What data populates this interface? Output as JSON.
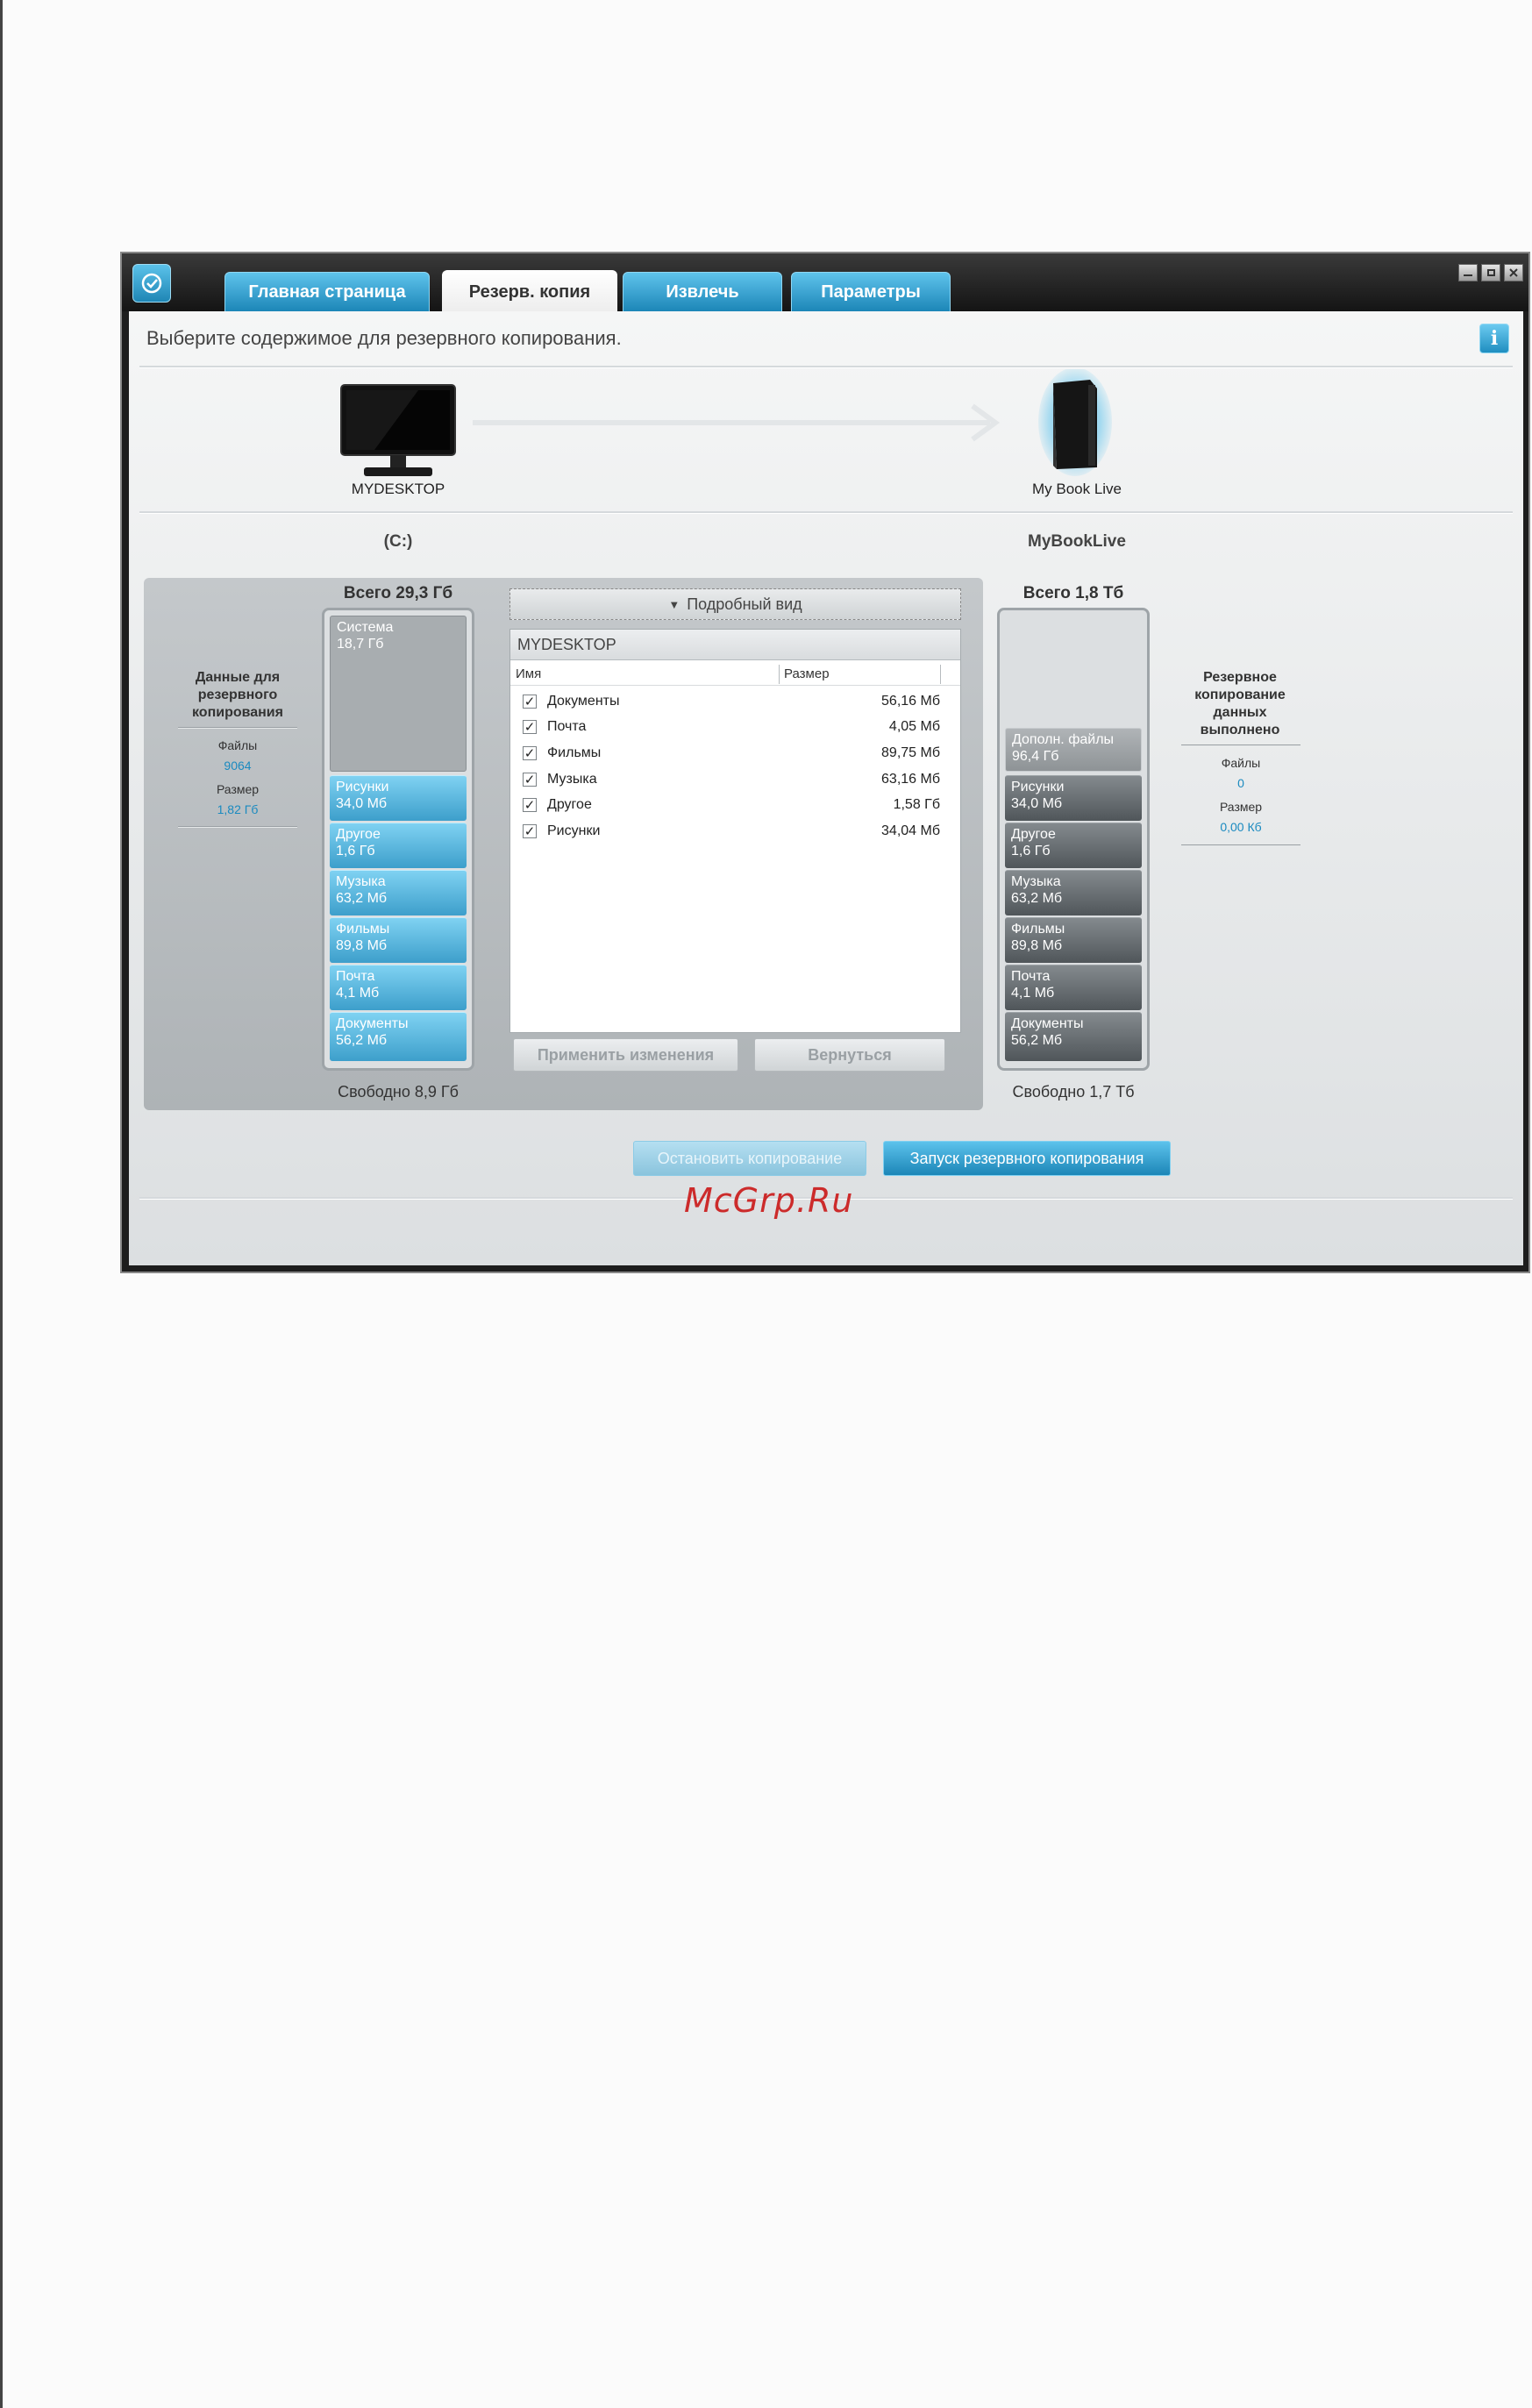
{
  "tabs": [
    "Главная страница",
    "Резерв. копия",
    "Извлечь",
    "Параметры"
  ],
  "instruction": "Выберите содержимое для резервного копирования.",
  "info_label": "i",
  "source": {
    "device": "MYDESKTOP",
    "drive": "(C:)",
    "total": "Всего 29,3 Гб",
    "free": "Свободно 8,9 Гб",
    "stats_title": "Данные для резервного копирования",
    "files_label": "Файлы",
    "files_value": "9064",
    "size_label": "Размер",
    "size_value": "1,82 Гб",
    "segments": [
      {
        "name": "Система",
        "value": "18,7 Гб"
      },
      {
        "name": "Рисунки",
        "value": "34,0 Мб"
      },
      {
        "name": "Другое",
        "value": "1,6 Гб"
      },
      {
        "name": "Музыка",
        "value": "63,2 Мб"
      },
      {
        "name": "Фильмы",
        "value": "89,8 Мб"
      },
      {
        "name": "Почта",
        "value": "4,1 Мб"
      },
      {
        "name": "Документы",
        "value": "56,2 Мб"
      }
    ]
  },
  "target": {
    "device": "My Book Live",
    "drive": "MyBookLive",
    "total": "Всего 1,8 Тб",
    "free": "Свободно 1,7 Тб",
    "stats_title": "Резервное копирование данных выполнено",
    "files_label": "Файлы",
    "files_value": "0",
    "size_label": "Размер",
    "size_value": "0,00 Кб",
    "segments": [
      {
        "name": "Дополн. файлы",
        "value": "96,4 Гб"
      },
      {
        "name": "Рисунки",
        "value": "34,0 Мб"
      },
      {
        "name": "Другое",
        "value": "1,6 Гб"
      },
      {
        "name": "Музыка",
        "value": "63,2 Мб"
      },
      {
        "name": "Фильмы",
        "value": "89,8 Мб"
      },
      {
        "name": "Почта",
        "value": "4,1 Мб"
      },
      {
        "name": "Документы",
        "value": "56,2 Мб"
      }
    ]
  },
  "detail": {
    "toggle_label": "Подробный вид",
    "list_title": "MYDESKTOP",
    "col_name": "Имя",
    "col_size": "Размер",
    "rows": [
      {
        "name": "Документы",
        "size": "56,16 Мб",
        "checked": true
      },
      {
        "name": "Почта",
        "size": "4,05 Мб",
        "checked": true
      },
      {
        "name": "Фильмы",
        "size": "89,75 Мб",
        "checked": true
      },
      {
        "name": "Музыка",
        "size": "63,16 Мб",
        "checked": true
      },
      {
        "name": "Другое",
        "size": "1,58 Гб",
        "checked": true
      },
      {
        "name": "Рисунки",
        "size": "34,04 Мб",
        "checked": true
      }
    ],
    "apply_label": "Применить изменения",
    "revert_label": "Вернуться"
  },
  "actions": {
    "stop_label": "Остановить копирование",
    "start_label": "Запуск резервного копирования"
  },
  "watermark": "McGrp.Ru",
  "colors": {
    "accent": "#1c86b7",
    "link": "#1a8ac0",
    "watermark": "#cc2b2b"
  }
}
